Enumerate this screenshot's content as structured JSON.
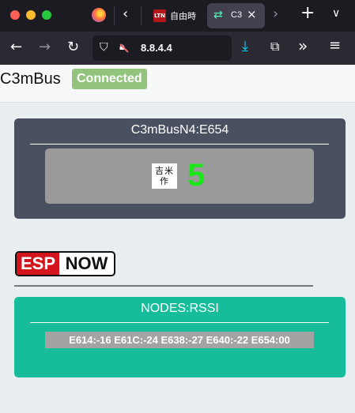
{
  "browser": {
    "tabs": [
      {
        "title": "自由時",
        "icon": "LTN",
        "active": false
      },
      {
        "title": "C3",
        "active": true
      }
    ],
    "url": "8.8.4.4"
  },
  "header": {
    "brand": "C3mBus",
    "status": "Connected",
    "status_color": "#93c47d"
  },
  "node_card": {
    "title": "C3mBusN4:E654",
    "seal_text": "吉米 作",
    "value": "5",
    "value_color": "#18e818"
  },
  "espnow_logo": {
    "esp": "ESP",
    "now": "NOW"
  },
  "rssi_card": {
    "title": "NODES:RSSI",
    "readings": "E614:-16 E61C:-24 E638:-27 E640:-22 E654:00",
    "accent": "#17bd9b"
  }
}
